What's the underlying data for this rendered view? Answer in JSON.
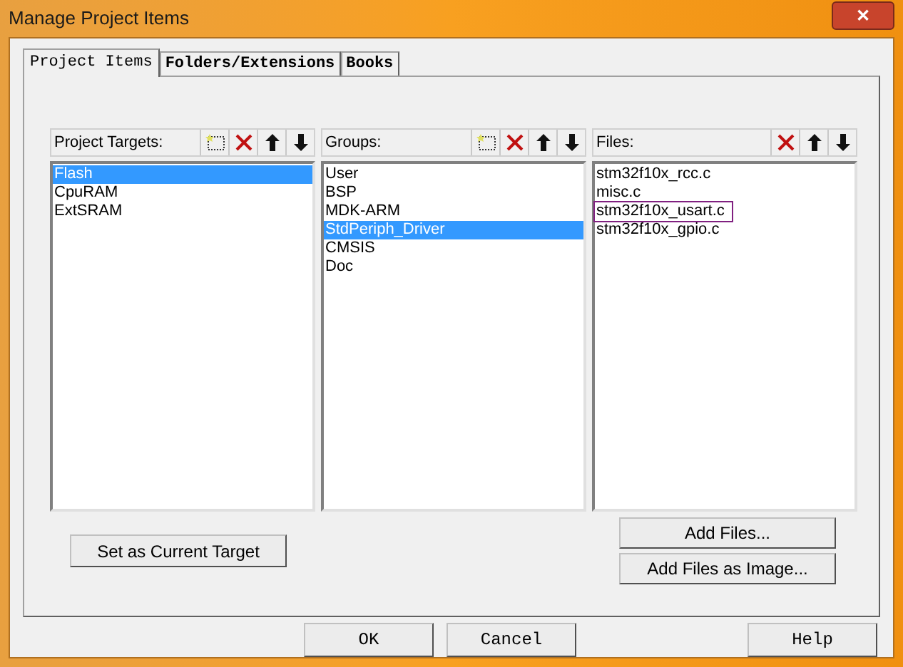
{
  "window": {
    "title": "Manage Project Items",
    "close_glyph": "✕"
  },
  "tabs": [
    {
      "label": "Project Items",
      "selected": true
    },
    {
      "label": "Folders/Extensions",
      "selected": false
    },
    {
      "label": "Books",
      "selected": false
    }
  ],
  "panels": [
    {
      "title": "Project Targets:",
      "tools": [
        {
          "kind": "new"
        },
        {
          "kind": "delete"
        },
        {
          "kind": "up"
        },
        {
          "kind": "down"
        }
      ],
      "items": [
        {
          "label": "Flash",
          "selected": true,
          "focused": false
        },
        {
          "label": "CpuRAM",
          "selected": false,
          "focused": false
        },
        {
          "label": "ExtSRAM",
          "selected": false,
          "focused": false
        }
      ]
    },
    {
      "title": "Groups:",
      "tools": [
        {
          "kind": "new"
        },
        {
          "kind": "delete"
        },
        {
          "kind": "up"
        },
        {
          "kind": "down"
        }
      ],
      "items": [
        {
          "label": "User",
          "selected": false,
          "focused": false
        },
        {
          "label": "BSP",
          "selected": false,
          "focused": false
        },
        {
          "label": "MDK-ARM",
          "selected": false,
          "focused": false
        },
        {
          "label": "StdPeriph_Driver",
          "selected": true,
          "focused": false
        },
        {
          "label": "CMSIS",
          "selected": false,
          "focused": false
        },
        {
          "label": "Doc",
          "selected": false,
          "focused": false
        }
      ]
    },
    {
      "title": "Files:",
      "tools": [
        {
          "kind": "delete"
        },
        {
          "kind": "up"
        },
        {
          "kind": "down"
        }
      ],
      "items": [
        {
          "label": "stm32f10x_rcc.c",
          "selected": false,
          "focused": false
        },
        {
          "label": "misc.c",
          "selected": false,
          "focused": false
        },
        {
          "label": "stm32f10x_usart.c",
          "selected": false,
          "focused": true
        },
        {
          "label": "stm32f10x_gpio.c",
          "selected": false,
          "focused": false
        }
      ]
    }
  ],
  "target_button": "Set as Current Target",
  "file_buttons": [
    "Add Files...",
    "Add Files as Image..."
  ],
  "dialog_buttons": [
    {
      "label": "OK"
    },
    {
      "label": "Cancel"
    },
    {
      "label": "Help"
    }
  ]
}
